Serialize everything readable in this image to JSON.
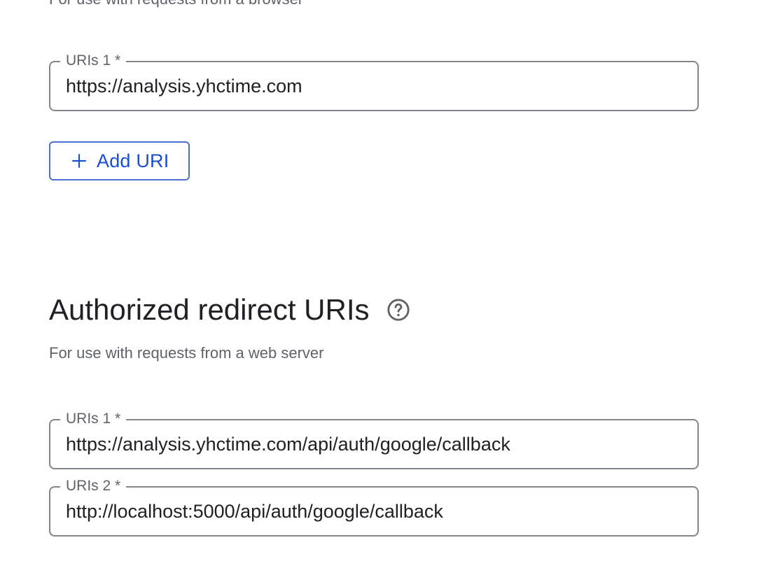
{
  "js_origins": {
    "subtitle_partial": "For use with requests from a browser",
    "uris": [
      {
        "label": "URIs 1 *",
        "value": "https://analysis.yhctime.com"
      }
    ],
    "add_uri_label": "Add URI"
  },
  "redirect_uris": {
    "title": "Authorized redirect URIs",
    "subtitle": "For use with requests from a web server",
    "uris": [
      {
        "label": "URIs 1 *",
        "value": "https://analysis.yhctime.com/api/auth/google/callback"
      },
      {
        "label": "URIs 2 *",
        "value": "http://localhost:5000/api/auth/google/callback"
      }
    ]
  },
  "icons": {
    "add": "plus-icon",
    "help": "help-circle-icon"
  },
  "colors": {
    "accent": "#1a4fd0",
    "border": "#80868b",
    "secondary_text": "#5f6368",
    "primary_text": "#202124"
  }
}
